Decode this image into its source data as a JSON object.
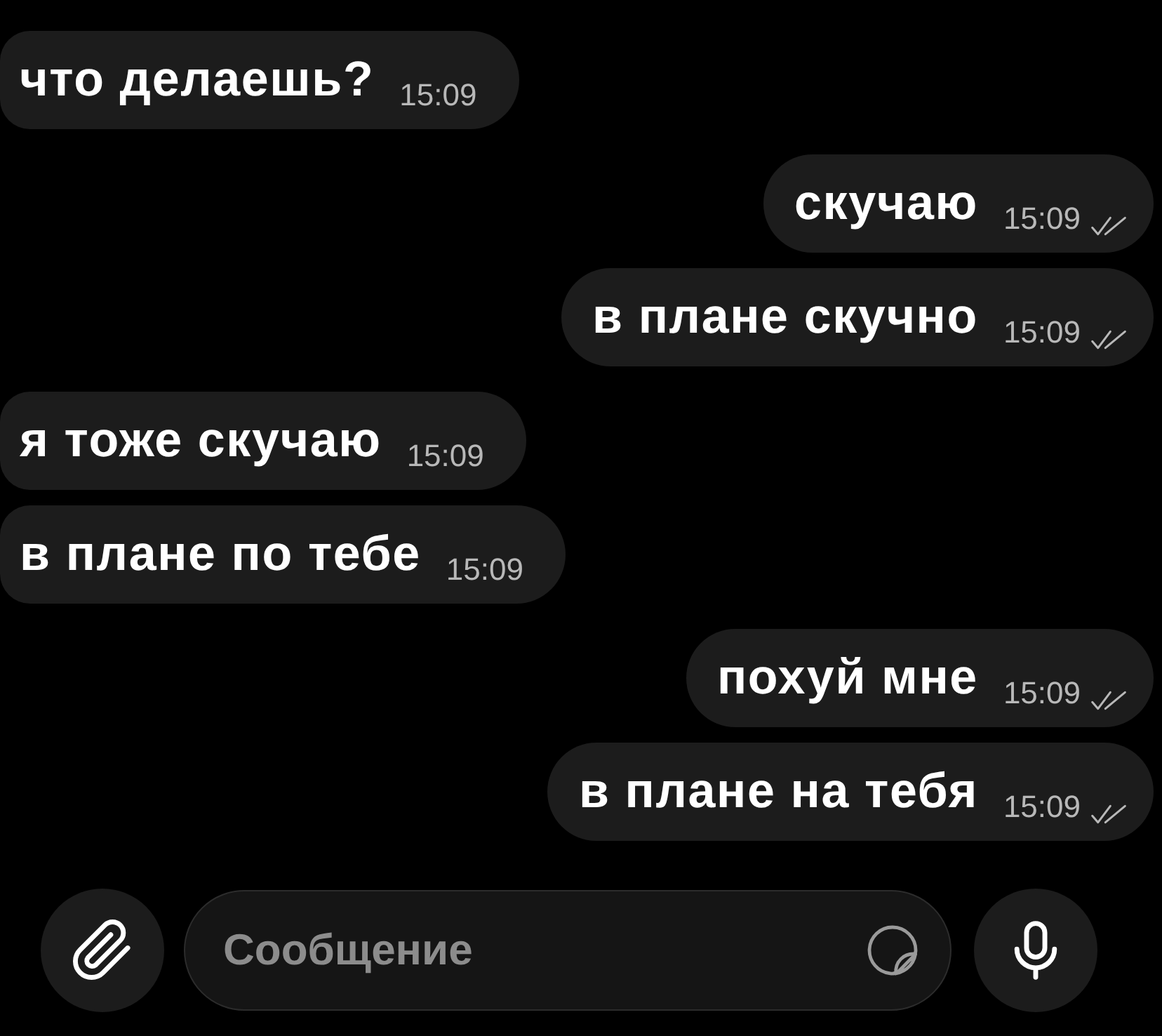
{
  "messages": [
    {
      "kind": "incoming",
      "text": "что делаешь?",
      "time": "15:09"
    },
    {
      "kind": "outgoing",
      "text": "скучаю",
      "time": "15:09",
      "read": true
    },
    {
      "kind": "outgoing",
      "text": "в плане скучно",
      "time": "15:09",
      "read": true
    },
    {
      "kind": "incoming",
      "text": "я тоже скучаю",
      "time": "15:09"
    },
    {
      "kind": "incoming",
      "text": "в плане по тебе",
      "time": "15:09"
    },
    {
      "kind": "outgoing",
      "text": "похуй мне",
      "time": "15:09",
      "read": true
    },
    {
      "kind": "outgoing",
      "text": "в плане на тебя",
      "time": "15:09",
      "read": true
    }
  ],
  "composer": {
    "placeholder": "Сообщение"
  }
}
